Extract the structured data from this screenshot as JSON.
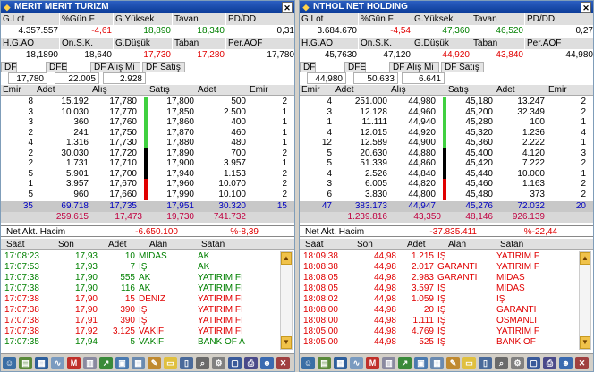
{
  "panels": [
    {
      "id": "left",
      "title": "MERIT MERIT TURIZM",
      "summary_headers": [
        "G.Lot",
        "%Gün.F",
        "G.Yüksek",
        "Tavan",
        "PD/DD"
      ],
      "summary_values": [
        "4.357.557",
        "-4,61",
        "18,890",
        "18,340",
        "0,31"
      ],
      "summary_headers2": [
        "H.G.AO",
        "On.S.K.",
        "G.Düşük",
        "Taban",
        "Per.AOF"
      ],
      "summary_values2": [
        "18,1890",
        "18,640",
        "17,730",
        "17,280",
        "17,780"
      ],
      "df_labels": [
        "DF",
        "DFE",
        "DF Alış Mi",
        "DF Satış"
      ],
      "df_values": [
        "17,780",
        "22.005",
        "2.928"
      ],
      "ob_headers": [
        "Emir",
        "Adet",
        "Alış",
        "Satış",
        "Adet",
        "Emir"
      ],
      "ob_rows": [
        [
          "8",
          "15.192",
          "17,780",
          "17,800",
          "500",
          "2"
        ],
        [
          "3",
          "10.030",
          "17,770",
          "17,850",
          "2.500",
          "1"
        ],
        [
          "3",
          "360",
          "17,760",
          "17,860",
          "400",
          "1"
        ],
        [
          "2",
          "241",
          "17,750",
          "17,870",
          "460",
          "1"
        ],
        [
          "4",
          "1.316",
          "17,730",
          "17,880",
          "480",
          "1"
        ],
        [
          "2",
          "30.030",
          "17,720",
          "17,890",
          "700",
          "2"
        ],
        [
          "2",
          "1.731",
          "17,710",
          "17,900",
          "3.957",
          "1"
        ],
        [
          "5",
          "5.901",
          "17,700",
          "17,940",
          "1.153",
          "2"
        ],
        [
          "1",
          "3.957",
          "17,670",
          "17,960",
          "10.070",
          "2"
        ],
        [
          "5",
          "960",
          "17,660",
          "17,990",
          "10.100",
          "2"
        ]
      ],
      "ob_total": [
        "35",
        "69.718",
        "17,735",
        "17,951",
        "30.320",
        "15"
      ],
      "ob_total2": [
        "259.615",
        "17,473",
        "19,730",
        "741.732"
      ],
      "net_label": "Net Akt. Hacim",
      "net_value": "-6.650.100",
      "net_pct": "%-8,39",
      "trade_headers": [
        "Saat",
        "Son",
        "Adet",
        "Alan",
        "Satan"
      ],
      "trades": [
        [
          "17:08:23",
          "17,93",
          "10",
          "MİDAS",
          "AK",
          "g"
        ],
        [
          "17:07:53",
          "17,93",
          "7",
          "İŞ",
          "AK",
          "g"
        ],
        [
          "17:07:38",
          "17,90",
          "555",
          "AK",
          "YATIRIM Fİ",
          "g"
        ],
        [
          "17:07:38",
          "17,90",
          "116",
          "AK",
          "YATIRIM Fİ",
          "g"
        ],
        [
          "17:07:38",
          "17,90",
          "15",
          "DENİZ",
          "YATIRIM Fİ",
          "r"
        ],
        [
          "17:07:38",
          "17,90",
          "390",
          "İŞ",
          "YATIRIM Fİ",
          "r"
        ],
        [
          "17:07:38",
          "17,91",
          "390",
          "İŞ",
          "YATIRIM Fİ",
          "r"
        ],
        [
          "17:07:38",
          "17,92",
          "3.125",
          "VAKIF",
          "YATIRIM Fİ",
          "r"
        ],
        [
          "17:07:35",
          "17,94",
          "5",
          "VAKIF",
          "BANK OF A",
          "g"
        ]
      ]
    },
    {
      "id": "right",
      "title": "NTHOL NET HOLDING",
      "summary_headers": [
        "G.Lot",
        "%Gün.F",
        "G.Yüksek",
        "Tavan",
        "PD/DD"
      ],
      "summary_values": [
        "3.684.670",
        "-4,54",
        "47,360",
        "46,520",
        "0,27"
      ],
      "summary_headers2": [
        "H.G.AO",
        "On.S.K.",
        "G.Düşük",
        "Taban",
        "Per.AOF"
      ],
      "summary_values2": [
        "45,7630",
        "47,120",
        "44,920",
        "43,840",
        "44,980"
      ],
      "df_labels": [
        "DF",
        "DFE",
        "DF Alış Mi",
        "DF Satış"
      ],
      "df_values": [
        "44,980",
        "50.633",
        "6.641"
      ],
      "ob_headers": [
        "Emir",
        "Adet",
        "Alış",
        "Satış",
        "Adet",
        "Emir"
      ],
      "ob_rows": [
        [
          "4",
          "251.000",
          "44,980",
          "45,180",
          "13.247",
          "2"
        ],
        [
          "3",
          "12.128",
          "44,960",
          "45,200",
          "32.349",
          "2"
        ],
        [
          "1",
          "11.111",
          "44,940",
          "45,280",
          "100",
          "1"
        ],
        [
          "4",
          "12.015",
          "44,920",
          "45,320",
          "1.236",
          "4"
        ],
        [
          "12",
          "12.589",
          "44,900",
          "45,360",
          "2.222",
          "1"
        ],
        [
          "5",
          "20.630",
          "44,880",
          "45,400",
          "4.120",
          "3"
        ],
        [
          "5",
          "51.339",
          "44,860",
          "45,420",
          "7.222",
          "2"
        ],
        [
          "4",
          "2.526",
          "44,840",
          "45,440",
          "10.000",
          "1"
        ],
        [
          "3",
          "6.005",
          "44,820",
          "45,460",
          "1.163",
          "2"
        ],
        [
          "6",
          "3.830",
          "44,800",
          "45,480",
          "373",
          "2"
        ]
      ],
      "ob_total": [
        "47",
        "383.173",
        "44,947",
        "45,276",
        "72.032",
        "20"
      ],
      "ob_total2": [
        "1.239.816",
        "43,350",
        "48,146",
        "926.139"
      ],
      "net_label": "Net Akt. Hacim",
      "net_value": "-37.835.411",
      "net_pct": "%-22,44",
      "trade_headers": [
        "Saat",
        "Son",
        "Adet",
        "Alan",
        "Satan"
      ],
      "trades": [
        [
          "18:09:38",
          "44,98",
          "1.215",
          "İŞ",
          "YATIRIM F",
          "r"
        ],
        [
          "18:08:38",
          "44,98",
          "2.017",
          "GARANTİ",
          "YATIRIM F",
          "r"
        ],
        [
          "18:08:05",
          "44,98",
          "2.983",
          "GARANTİ",
          "MİDAS",
          "r"
        ],
        [
          "18:08:05",
          "44,98",
          "3.597",
          "İŞ",
          "MİDAS",
          "r"
        ],
        [
          "18:08:02",
          "44,98",
          "1.059",
          "İŞ",
          "İŞ",
          "r"
        ],
        [
          "18:08:00",
          "44,98",
          "20",
          "İŞ",
          "GARANTİ",
          "r"
        ],
        [
          "18:08:00",
          "44,98",
          "1.111",
          "İŞ",
          "OSMANLI",
          "r"
        ],
        [
          "18:05:00",
          "44,98",
          "4.769",
          "İŞ",
          "YATIRIM F",
          "r"
        ],
        [
          "18:05:00",
          "44,98",
          "525",
          "İŞ",
          "BANK OF",
          "r"
        ]
      ]
    }
  ],
  "toolbar_icons": [
    "users-icon",
    "chart-icon",
    "grid-icon",
    "wave-icon",
    "m-logo-icon",
    "doc-icon",
    "arrow-icon",
    "news-icon",
    "table-icon",
    "pencil-icon",
    "note-icon",
    "book-icon",
    "magnify-icon",
    "gear-icon",
    "window-icon",
    "print-icon",
    "user-icon",
    "close-icon"
  ]
}
